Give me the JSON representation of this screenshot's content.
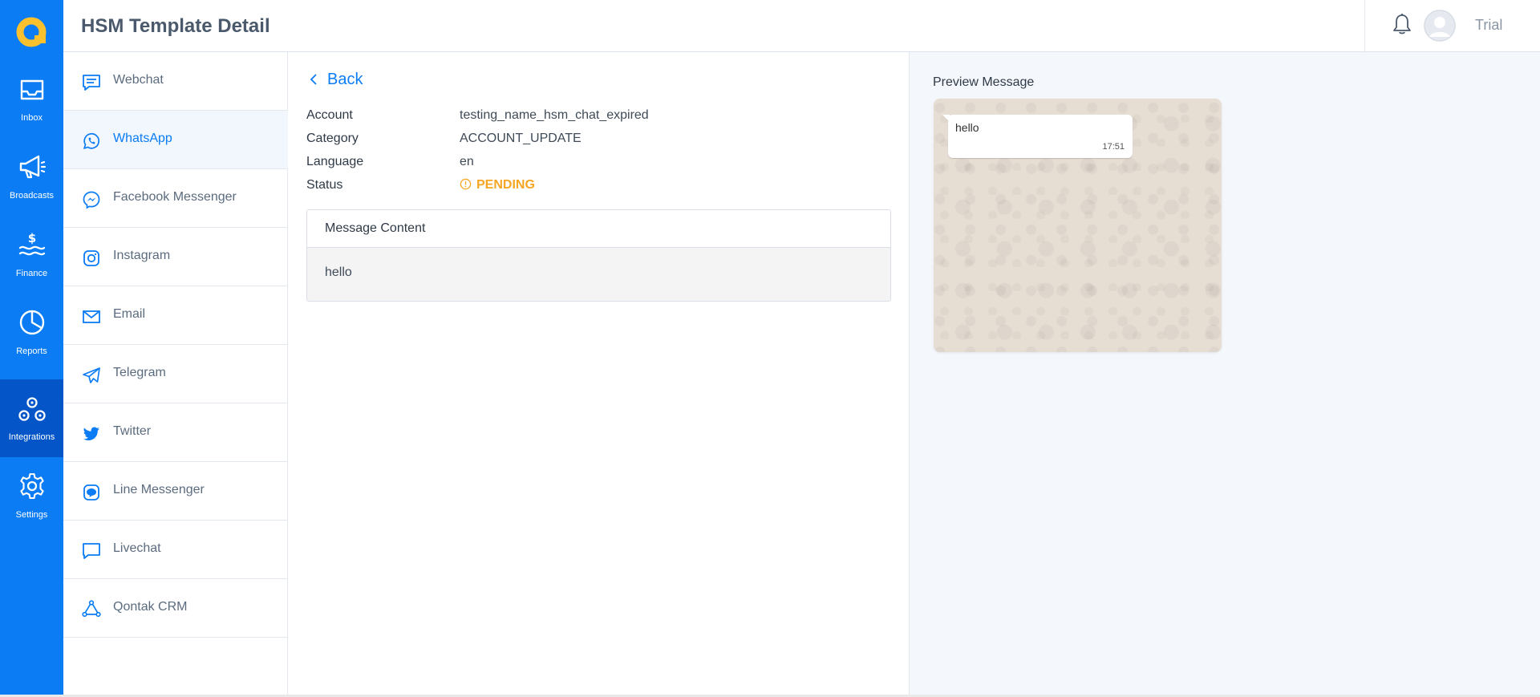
{
  "header": {
    "title": "HSM Template Detail",
    "username": "Trial"
  },
  "rail": {
    "items": [
      {
        "label": "Inbox",
        "icon": "inbox-icon"
      },
      {
        "label": "Broadcasts",
        "icon": "megaphone-icon"
      },
      {
        "label": "Finance",
        "icon": "finance-icon"
      },
      {
        "label": "Reports",
        "icon": "pie-chart-icon"
      },
      {
        "label": "Integrations",
        "icon": "integrations-icon",
        "active": true
      },
      {
        "label": "Settings",
        "icon": "gear-icon"
      }
    ]
  },
  "channels": {
    "active": "WhatsApp",
    "items": [
      {
        "label": "Webchat",
        "icon": "webchat-icon"
      },
      {
        "label": "WhatsApp",
        "icon": "whatsapp-icon"
      },
      {
        "label": "Facebook Messenger",
        "icon": "messenger-icon"
      },
      {
        "label": "Instagram",
        "icon": "instagram-icon"
      },
      {
        "label": "Email",
        "icon": "email-icon"
      },
      {
        "label": "Telegram",
        "icon": "telegram-icon"
      },
      {
        "label": "Twitter",
        "icon": "twitter-icon"
      },
      {
        "label": "Line Messenger",
        "icon": "line-icon"
      },
      {
        "label": "Livechat",
        "icon": "livechat-icon"
      },
      {
        "label": "Qontak CRM",
        "icon": "crm-icon"
      }
    ]
  },
  "detail": {
    "back_label": "Back",
    "fields": [
      {
        "label": "Account",
        "value": "testing_name_hsm_chat_expired"
      },
      {
        "label": "Category",
        "value": "ACCOUNT_UPDATE"
      },
      {
        "label": "Language",
        "value": "en"
      },
      {
        "label": "Status",
        "value": "PENDING"
      }
    ],
    "content_title": "Message Content",
    "content_body": "hello"
  },
  "preview": {
    "title": "Preview Message",
    "message": "hello",
    "time": "17:51"
  },
  "colors": {
    "brand_blue": "#0b7cf4",
    "rail_active": "#0456c8",
    "status_pending": "#f5a623",
    "logo_yellow": "#fbc02d"
  }
}
